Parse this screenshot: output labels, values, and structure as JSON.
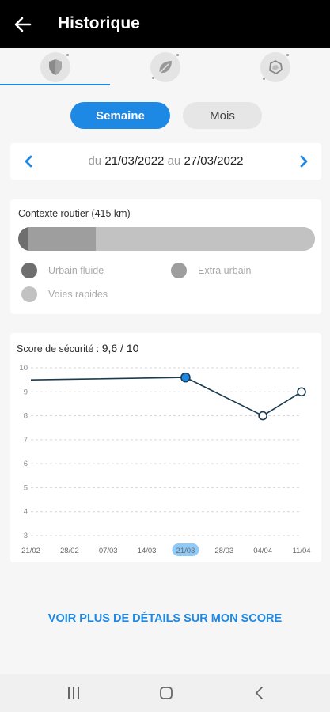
{
  "header": {
    "title": "Historique",
    "back_icon": "arrow-left-icon"
  },
  "tabs": [
    {
      "name": "safety",
      "icon": "shield-icon",
      "active": true
    },
    {
      "name": "eco",
      "icon": "leaf-icon",
      "active": false
    },
    {
      "name": "other",
      "icon": "cube-icon",
      "active": false
    }
  ],
  "period": {
    "week_label": "Semaine",
    "month_label": "Mois",
    "selected": "week"
  },
  "date_range": {
    "from_prefix": "du",
    "from": "21/03/2022",
    "to_prefix": "au",
    "to": "27/03/2022"
  },
  "context": {
    "title": "Contexte routier (415 km)",
    "bar": [
      {
        "label": "Urbain fluide",
        "fraction": 0.035,
        "color": "#6e6e6e"
      },
      {
        "label": "Extra urbain",
        "fraction": 0.225,
        "color": "#9e9e9e"
      },
      {
        "label": "Voies rapides",
        "fraction": 0.74,
        "color": "#c2c2c2"
      }
    ],
    "legend": [
      {
        "label": "Urbain fluide",
        "color": "#6e6e6e"
      },
      {
        "label": "Extra urbain",
        "color": "#9e9e9e"
      },
      {
        "label": "Voies rapides",
        "color": "#c2c2c2"
      }
    ]
  },
  "score": {
    "label": "Score de sécurité :",
    "value": "9,6 / 10"
  },
  "chart_data": {
    "type": "line",
    "x": [
      "21/02",
      "28/02",
      "07/03",
      "14/03",
      "21/03",
      "28/03",
      "04/04",
      "11/04"
    ],
    "ylim": [
      3,
      10
    ],
    "yticks": [
      3,
      4,
      5,
      6,
      7,
      8,
      9,
      10
    ],
    "grid": true,
    "selected_x": "21/03",
    "series": [
      {
        "points": [
          {
            "x": "21/02",
            "y": 9.5
          },
          {
            "x": "21/03",
            "y": 9.6
          },
          {
            "x": "04/04",
            "y": 8.0
          },
          {
            "x": "11/04",
            "y": 9.0
          }
        ]
      }
    ],
    "colors": {
      "line": "#1b3b4f",
      "selected_point": "#1e88e5",
      "highlight_label_bg": "#90caf9"
    }
  },
  "details_link": "VOIR PLUS DE DÉTAILS SUR MON SCORE",
  "navbar": {
    "recents_icon": "recents-icon",
    "home_icon": "home-icon",
    "back_icon": "nav-back-icon"
  }
}
